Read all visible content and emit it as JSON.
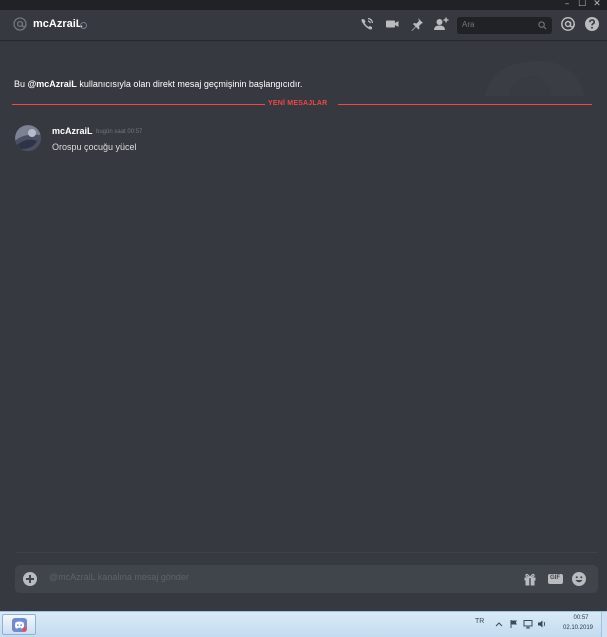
{
  "window": {
    "minimize_glyph": "–",
    "maximize_glyph": "☐",
    "close_glyph": "✕"
  },
  "header": {
    "channel_icon": "at-icon",
    "username": "mcAzraiL",
    "status": "offline",
    "icons": [
      "call-icon",
      "video-icon",
      "pin-icon",
      "add-friend-icon"
    ],
    "search_placeholder": "Ara",
    "mentions_icon": "at-mention-icon",
    "help_icon": "help-icon"
  },
  "intro": {
    "prefix": "Bu ",
    "mention": "@mcAzraiL",
    "suffix": " kullanıcısıyla olan direkt mesaj geçmişinin başlangıcıdır."
  },
  "divider": {
    "label": "YENİ MESAJLAR",
    "color": "#f04747"
  },
  "message": {
    "author": "mcAzraiL",
    "timestamp": "bugün saat 00:57",
    "text": "Orospu çocuğu  yücel"
  },
  "compose": {
    "placeholder": "@mcAzraiL kanalına mesaj gönder",
    "gift_label": "gift-icon",
    "gif_label": "GIF",
    "emoji_label": "emoji-icon"
  },
  "taskbar": {
    "language": "TR",
    "time": "00:57",
    "date": "02.10.2019"
  },
  "colors": {
    "background": "#36393f",
    "header_bg": "#36393f",
    "input_bg": "#40444b",
    "accent_red": "#f04747"
  }
}
